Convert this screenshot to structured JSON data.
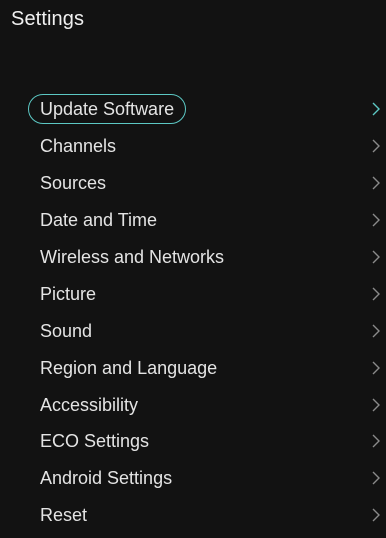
{
  "header": {
    "title": "Settings"
  },
  "colors": {
    "background": "#121212",
    "text": "#e4e4e4",
    "accent": "#5cc8c4",
    "chevron": "#8a8a8a",
    "chevron_selected": "#5cc8c4"
  },
  "menu": {
    "selected_index": 0,
    "items": [
      {
        "label": "Update Software",
        "icon": "chevron-right-icon"
      },
      {
        "label": "Channels",
        "icon": "chevron-right-icon"
      },
      {
        "label": "Sources",
        "icon": "chevron-right-icon"
      },
      {
        "label": "Date and Time",
        "icon": "chevron-right-icon"
      },
      {
        "label": "Wireless and Networks",
        "icon": "chevron-right-icon"
      },
      {
        "label": "Picture",
        "icon": "chevron-right-icon"
      },
      {
        "label": "Sound",
        "icon": "chevron-right-icon"
      },
      {
        "label": "Region and Language",
        "icon": "chevron-right-icon"
      },
      {
        "label": "Accessibility",
        "icon": "chevron-right-icon"
      },
      {
        "label": "ECO Settings",
        "icon": "chevron-right-icon"
      },
      {
        "label": "Android Settings",
        "icon": "chevron-right-icon"
      },
      {
        "label": "Reset",
        "icon": "chevron-right-icon"
      }
    ]
  }
}
